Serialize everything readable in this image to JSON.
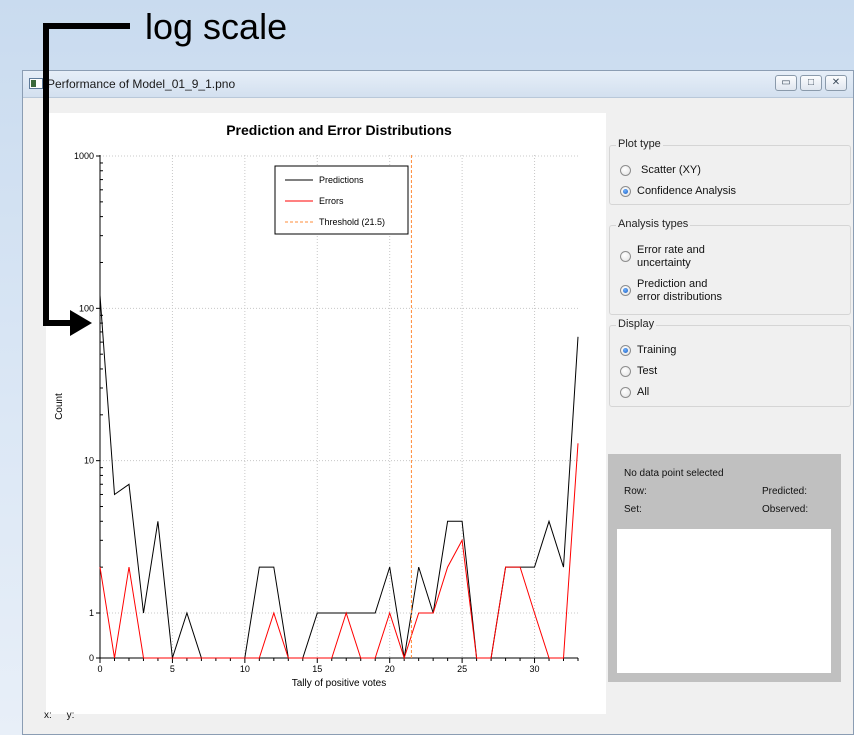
{
  "annotation": {
    "label": "log scale"
  },
  "window": {
    "title": "Performance of Model_01_9_1.pno",
    "buttons": {
      "minimize": "▭",
      "maximize": "□",
      "close": "✕"
    }
  },
  "chart_data": {
    "type": "line",
    "title": "Prediction and Error Distributions",
    "xlabel": "Tally of positive votes",
    "ylabel": "Count",
    "yscale": "log",
    "xlim": [
      0,
      33
    ],
    "xticks": [
      0,
      5,
      10,
      15,
      20,
      25,
      30
    ],
    "yticks": [
      {
        "value": 0,
        "label": "0"
      },
      {
        "value": 1,
        "label": "1"
      },
      {
        "value": 10,
        "label": "10"
      },
      {
        "value": 100,
        "label": "100"
      },
      {
        "value": 1000,
        "label": "1000"
      }
    ],
    "grid": true,
    "legend_position": "top-center",
    "series": [
      {
        "name": "Predictions",
        "color": "#000000",
        "x": [
          0,
          1,
          2,
          3,
          4,
          5,
          6,
          7,
          8,
          9,
          10,
          11,
          12,
          13,
          14,
          15,
          16,
          17,
          18,
          19,
          20,
          21,
          22,
          23,
          24,
          25,
          26,
          27,
          28,
          29,
          30,
          31,
          32,
          33
        ],
        "y": [
          122,
          6,
          7,
          1,
          4,
          0,
          1,
          0,
          0,
          0,
          0,
          2,
          2,
          0,
          0,
          1,
          1,
          1,
          1,
          1,
          2,
          0,
          2,
          1,
          4,
          4,
          0,
          0,
          2,
          2,
          2,
          4,
          2,
          65
        ]
      },
      {
        "name": "Errors",
        "color": "#ff0000",
        "x": [
          0,
          1,
          2,
          3,
          4,
          5,
          6,
          7,
          8,
          9,
          10,
          11,
          12,
          13,
          14,
          15,
          16,
          17,
          18,
          19,
          20,
          21,
          22,
          23,
          24,
          25,
          26,
          27,
          28,
          29,
          30,
          31,
          32,
          33
        ],
        "y": [
          2,
          0,
          2,
          0,
          0,
          0,
          0,
          0,
          0,
          0,
          0,
          0,
          1,
          0,
          0,
          0,
          0,
          1,
          0,
          0,
          1,
          0,
          1,
          1,
          2,
          3,
          0,
          0,
          2,
          2,
          1,
          0,
          0,
          13
        ]
      },
      {
        "name": "Threshold (21.5)",
        "color": "#ff8c3a",
        "dashed": true,
        "x_value": 21.5
      }
    ]
  },
  "controls": {
    "plot_type": {
      "title": "Plot type",
      "options": [
        "Scatter (XY)",
        "Confidence Analysis"
      ],
      "selected": 1
    },
    "analysis_types": {
      "title": "Analysis types",
      "options": [
        [
          "Error rate and",
          "uncertainty"
        ],
        [
          "Prediction and",
          "error distributions"
        ]
      ],
      "selected": 1
    },
    "display": {
      "title": "Display",
      "options": [
        "Training",
        "Test",
        "All"
      ],
      "selected": 0
    }
  },
  "info": {
    "no_selection": "No data point selected",
    "row_label": "Row:",
    "set_label": "Set:",
    "predicted_label": "Predicted:",
    "observed_label": "Observed:"
  },
  "status": {
    "x_label": "x:",
    "y_label": "y:"
  }
}
